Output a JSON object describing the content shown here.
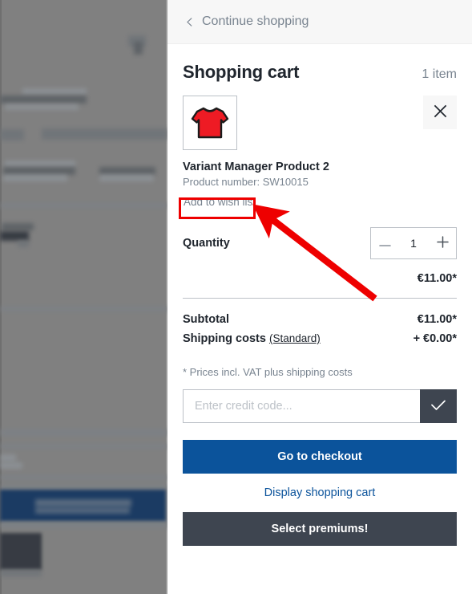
{
  "panel": {
    "back_label": "Continue shopping",
    "back_icon": "chevron-left-icon",
    "title": "Shopping cart",
    "item_count": "1 item"
  },
  "product": {
    "image_alt": "red-long-sleeve-shirt-thumbnail",
    "name": "Variant Manager Product 2",
    "product_number": "Product number: SW10015",
    "wishlist_label": "Add to wish list",
    "remove_icon": "close-icon",
    "quantity_label": "Quantity",
    "quantity_value": "1",
    "decrease_icon": "minus-icon",
    "increase_icon": "plus-icon",
    "line_price": "€11.00*"
  },
  "totals": {
    "subtotal_label": "Subtotal",
    "subtotal_value": "€11.00*",
    "shipping_label": "Shipping costs",
    "shipping_method": "(Standard)",
    "shipping_value": "+ €0.00*",
    "vat_note": "* Prices incl. VAT plus shipping costs"
  },
  "credit": {
    "placeholder": "Enter credit code...",
    "value": "",
    "submit_icon": "check-icon"
  },
  "actions": {
    "checkout_label": "Go to checkout",
    "display_cart_label": "Display shopping cart",
    "premiums_label": "Select premiums!"
  },
  "annotation": {
    "highlight_target": "Add to wish list",
    "color": "#ee0000"
  },
  "colors": {
    "primary_blue": "#0b539b",
    "dark_slate": "#3e4550",
    "muted_text": "#798490",
    "heading_text": "#20262e",
    "border": "#bcc1c7",
    "header_bg": "#f7f7f7",
    "annotation_red": "#ee0000",
    "backdrop": "#808080"
  }
}
